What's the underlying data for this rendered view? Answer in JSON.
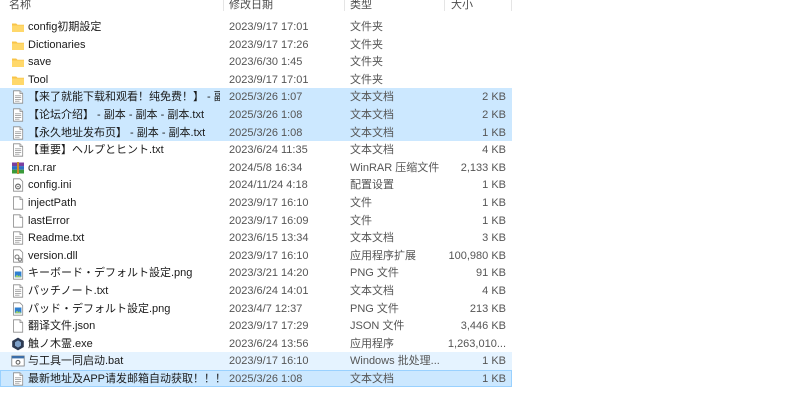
{
  "columns": {
    "name": "名称",
    "date": "修改日期",
    "type": "类型",
    "size": "大小"
  },
  "files": [
    {
      "name": "config初期設定",
      "date": "2023/9/17 17:01",
      "type": "文件夹",
      "size": "",
      "icon": "folder-icon"
    },
    {
      "name": "Dictionaries",
      "date": "2023/9/17 17:26",
      "type": "文件夹",
      "size": "",
      "icon": "folder-icon"
    },
    {
      "name": "save",
      "date": "2023/6/30 1:45",
      "type": "文件夹",
      "size": "",
      "icon": "folder-icon"
    },
    {
      "name": "Tool",
      "date": "2023/9/17 17:01",
      "type": "文件夹",
      "size": "",
      "icon": "folder-icon"
    },
    {
      "name": "【来了就能下载和观看！纯免费！】 - 副本 - 副本.txt",
      "date": "2025/3/26 1:07",
      "type": "文本文档",
      "size": "2 KB",
      "icon": "text-file-icon"
    },
    {
      "name": "【论坛介绍】 - 副本 - 副本 - 副本.txt",
      "date": "2025/3/26 1:08",
      "type": "文本文档",
      "size": "2 KB",
      "icon": "text-file-icon"
    },
    {
      "name": "【永久地址发布页】 - 副本 - 副本.txt",
      "date": "2025/3/26 1:08",
      "type": "文本文档",
      "size": "1 KB",
      "icon": "text-file-icon"
    },
    {
      "name": "【重要】ヘルプとヒント.txt",
      "date": "2023/6/24 11:35",
      "type": "文本文档",
      "size": "4 KB",
      "icon": "text-file-icon"
    },
    {
      "name": "cn.rar",
      "date": "2024/5/8 16:34",
      "type": "WinRAR 压缩文件",
      "size": "2,133 KB",
      "icon": "winrar-archive-icon"
    },
    {
      "name": "config.ini",
      "date": "2024/11/24 4:18",
      "type": "配置设置",
      "size": "1 KB",
      "icon": "config-file-icon"
    },
    {
      "name": "injectPath",
      "date": "2023/9/17 16:10",
      "type": "文件",
      "size": "1 KB",
      "icon": "blank-file-icon"
    },
    {
      "name": "lastError",
      "date": "2023/9/17 16:09",
      "type": "文件",
      "size": "1 KB",
      "icon": "blank-file-icon"
    },
    {
      "name": "Readme.txt",
      "date": "2023/6/15 13:34",
      "type": "文本文档",
      "size": "3 KB",
      "icon": "text-file-icon"
    },
    {
      "name": "version.dll",
      "date": "2023/9/17 16:10",
      "type": "应用程序扩展",
      "size": "100,980 KB",
      "icon": "dll-file-icon"
    },
    {
      "name": "キーボード・デフォルト設定.png",
      "date": "2023/3/21 14:20",
      "type": "PNG 文件",
      "size": "91 KB",
      "icon": "image-file-icon"
    },
    {
      "name": "パッチノート.txt",
      "date": "2023/6/24 14:01",
      "type": "文本文档",
      "size": "4 KB",
      "icon": "text-file-icon"
    },
    {
      "name": "パッド・デフォルト設定.png",
      "date": "2023/4/7 12:37",
      "type": "PNG 文件",
      "size": "213 KB",
      "icon": "image-file-icon"
    },
    {
      "name": "翻译文件.json",
      "date": "2023/9/17 17:29",
      "type": "JSON 文件",
      "size": "3,446 KB",
      "icon": "blank-file-icon"
    },
    {
      "name": "触ノ木霊.exe",
      "date": "2023/6/24 13:56",
      "type": "应用程序",
      "size": "1,263,010...",
      "icon": "exe-app-icon"
    },
    {
      "name": "与工具一同启动.bat",
      "date": "2023/9/17 16:10",
      "type": "Windows 批处理...",
      "size": "1 KB",
      "icon": "batch-file-icon"
    },
    {
      "name": "最新地址及APP请发邮箱自动获取！！！...",
      "date": "2025/3/26 1:08",
      "type": "文本文档",
      "size": "1 KB",
      "icon": "text-file-icon"
    }
  ]
}
